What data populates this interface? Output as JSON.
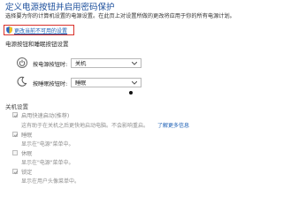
{
  "page": {
    "title": "定义电源按钮并启用密码保护",
    "description": "选择要为你的计算机设置的电源设置。在此页上对设置所做的更改将应用于你的所有电源计划。"
  },
  "change_link": {
    "label": "更改当前不可用的设置",
    "icon": "shield-icon",
    "highlight_color": "#d9312b"
  },
  "power_section": {
    "heading": "电源按钮和睡眠按钮设置",
    "rows": [
      {
        "label": "按电源按钮时:",
        "value": "关机",
        "icon": "power-icon"
      },
      {
        "label": "按睡眠按钮时:",
        "value": "睡眠",
        "icon": "moon-icon"
      }
    ]
  },
  "shutdown_section": {
    "heading": "关机设置",
    "items": [
      {
        "label": "启用快速启动(推荐)",
        "description": "这有助于在关机之后更快地启动电脑。不会影响重启。",
        "link": "了解更多信息",
        "checked": true
      },
      {
        "label": "睡眠",
        "description": "显示在\"电源\"菜单中。",
        "checked": true
      },
      {
        "label": "休眠",
        "description": "显示在\"电源\"菜单中。",
        "checked": false
      },
      {
        "label": "锁定",
        "description": "显示在用户头像菜单中。",
        "checked": true
      }
    ]
  }
}
